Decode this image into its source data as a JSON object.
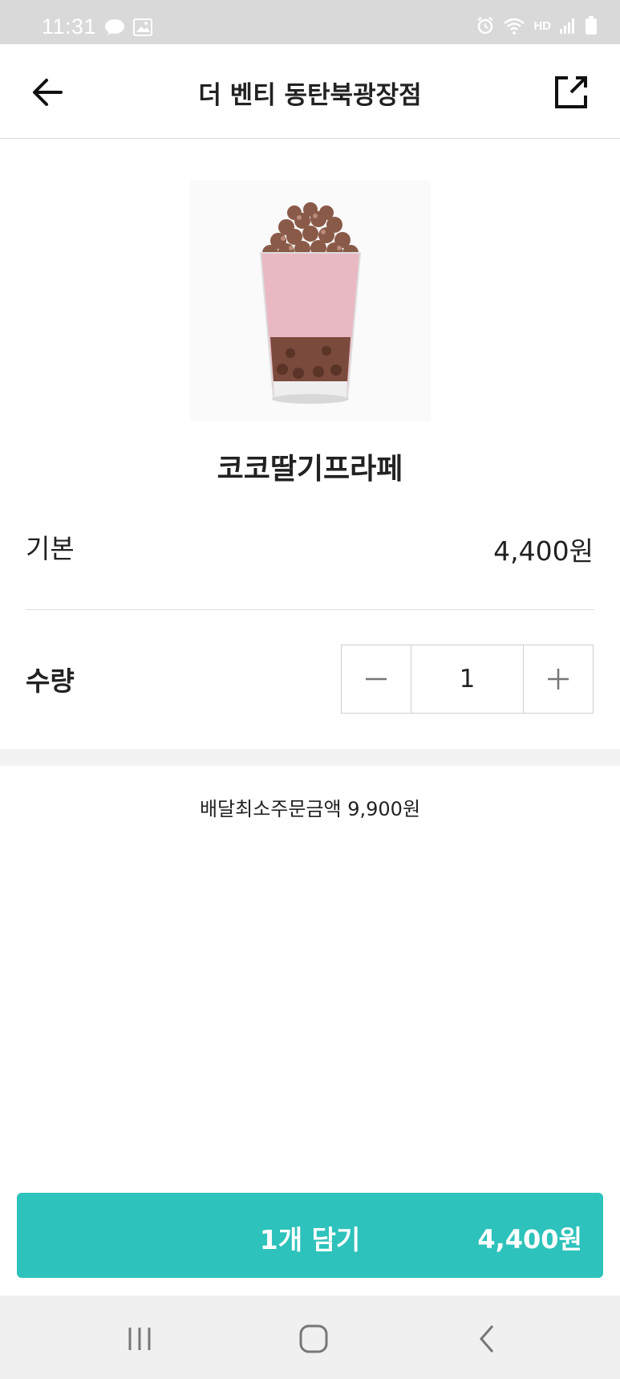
{
  "status_bar": {
    "time": "11:31",
    "left_icons": [
      "chat-bubble-icon",
      "image-icon"
    ],
    "right_icons": [
      "alarm-icon",
      "wifi-icon",
      "hd-voice-icon",
      "signal-icon",
      "battery-icon"
    ],
    "hd_label": "HD"
  },
  "header": {
    "title": "더 벤티 동탄북광장점",
    "back_icon": "arrow-left-icon",
    "share_icon": "share-external-icon"
  },
  "product": {
    "name": "코코딸기프라페"
  },
  "options": {
    "base_label": "기본",
    "base_price": "4,400원",
    "quantity_label": "수량",
    "quantity_value": "1",
    "minus_symbol": "−",
    "plus_symbol": "+"
  },
  "min_order": "배달최소주문금액 9,900원",
  "cart_button": {
    "label": "1개 담기",
    "price": "4,400원",
    "color": "#2dc2bb"
  },
  "nav": {
    "icons": [
      "recent-apps-icon",
      "home-icon",
      "back-icon"
    ]
  }
}
